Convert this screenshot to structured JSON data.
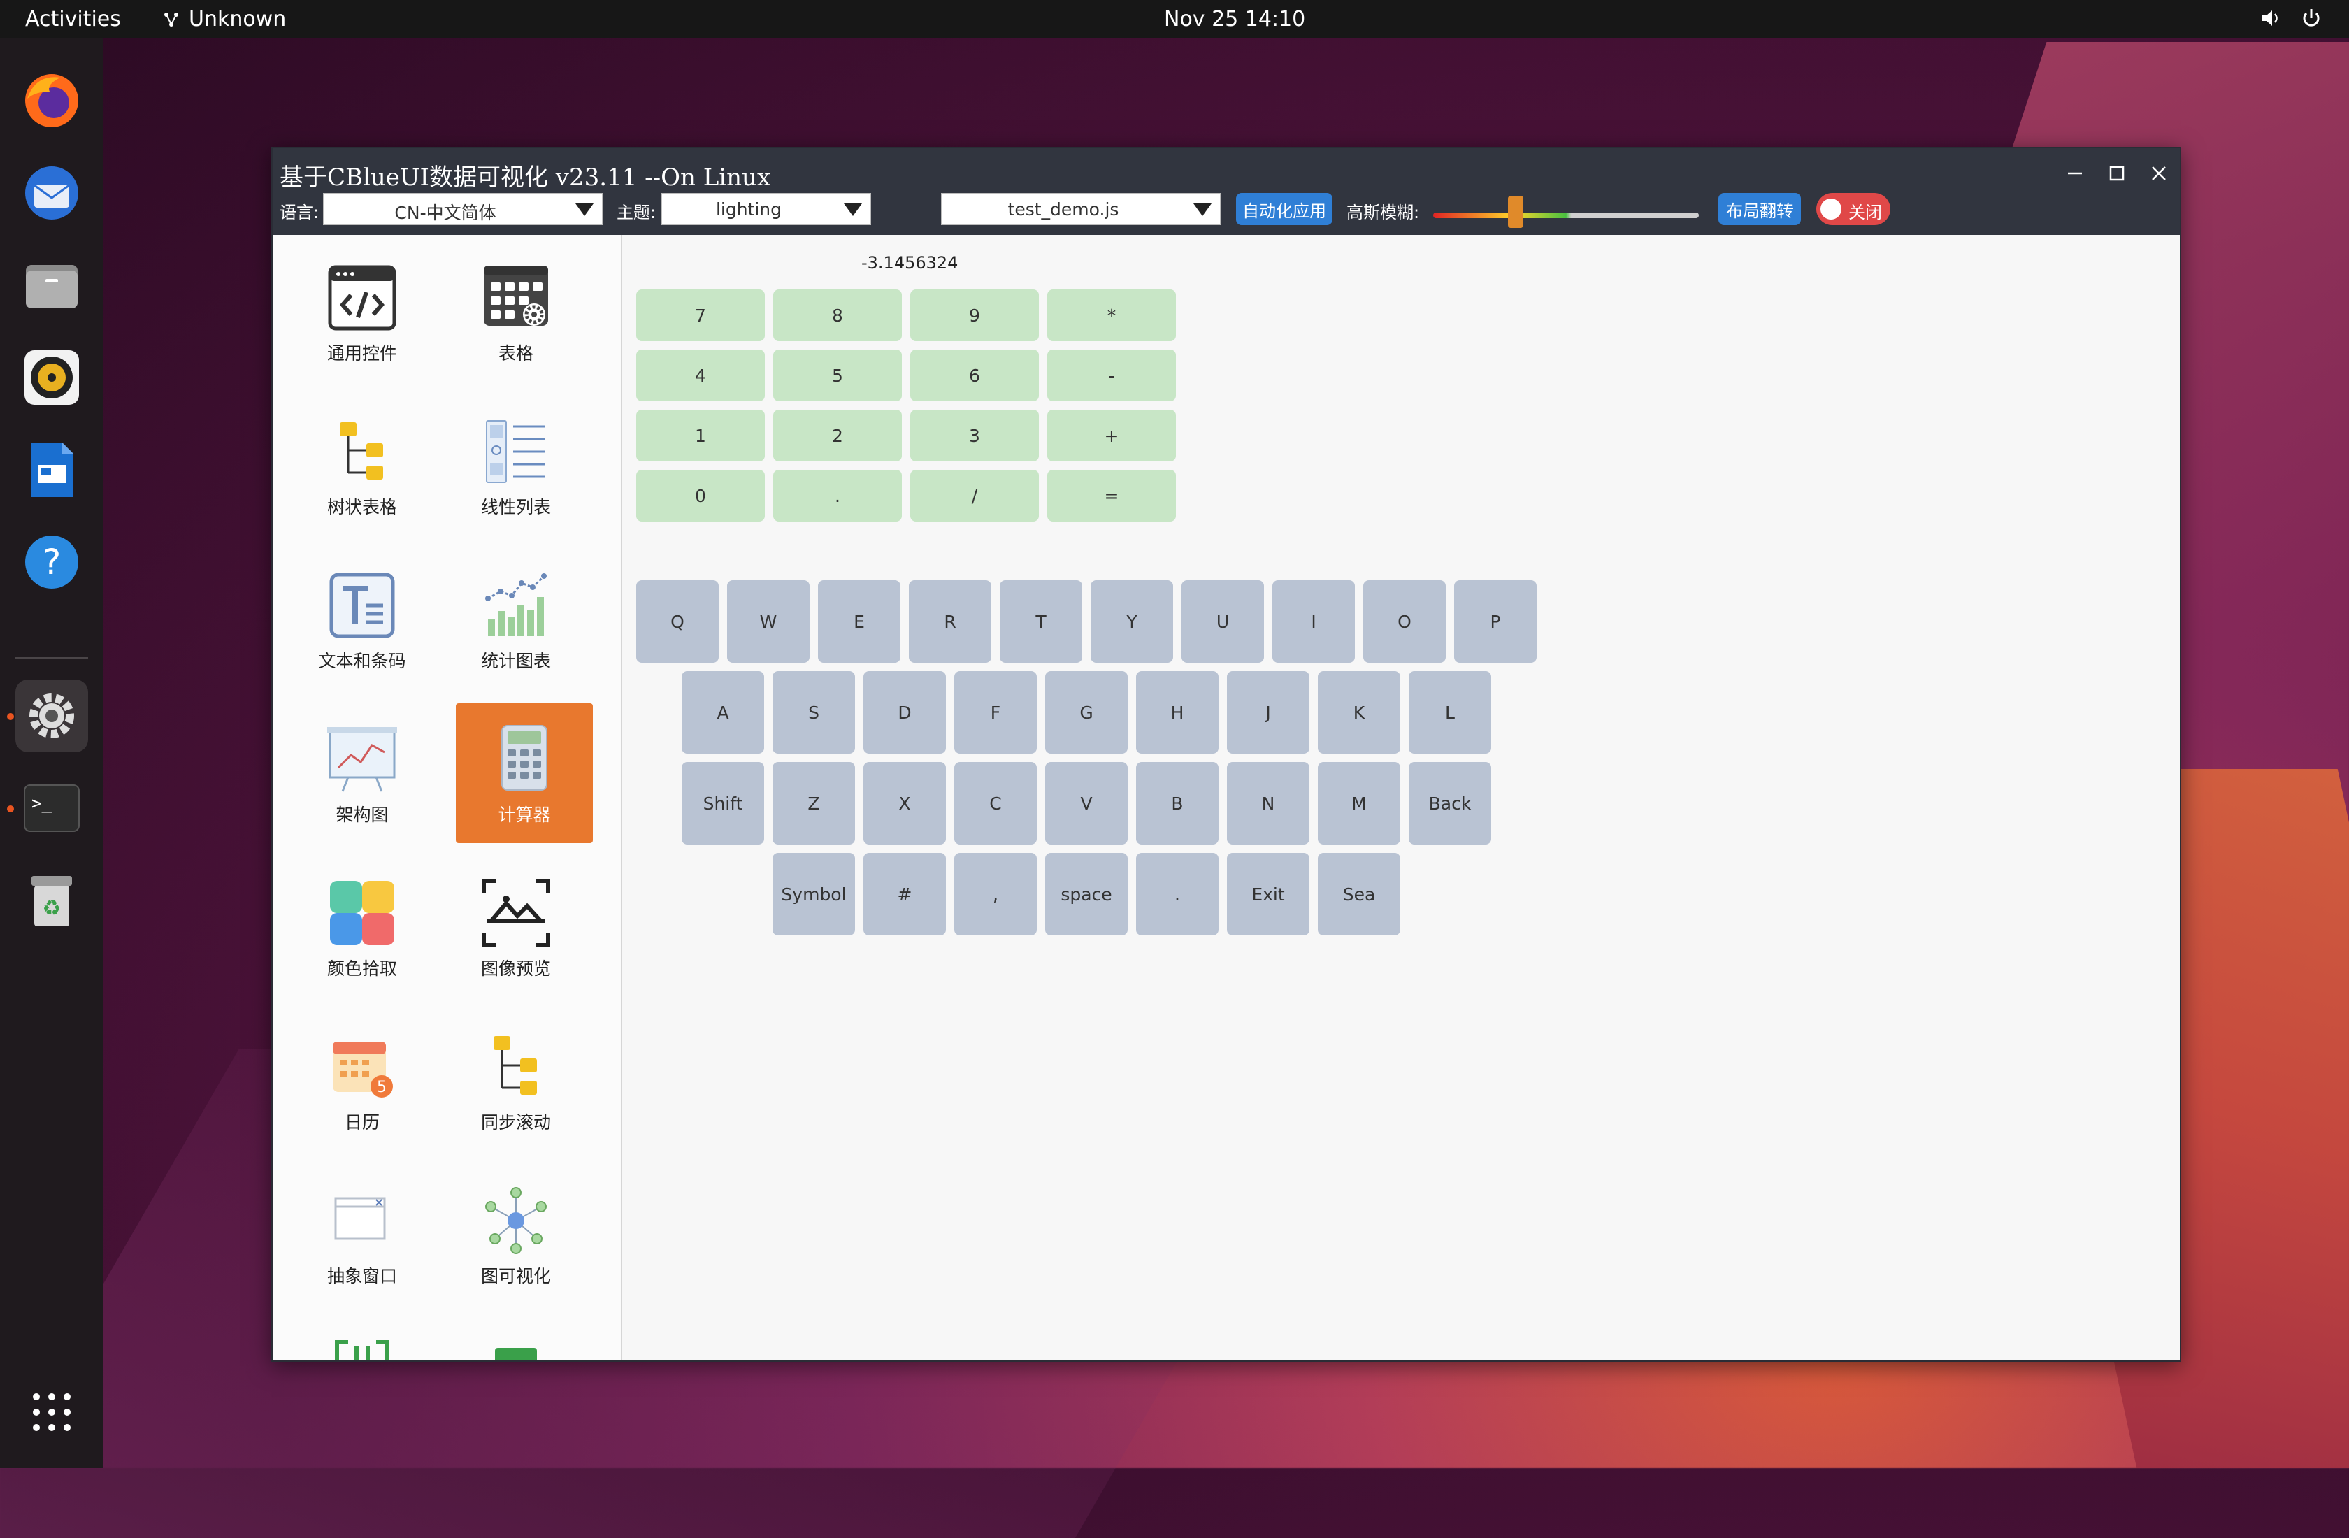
{
  "topbar": {
    "activities": "Activities",
    "app_name": "Unknown",
    "clock": "Nov 25  14:10"
  },
  "dock": {
    "items": [
      "firefox-icon",
      "thunderbird-icon",
      "files-icon",
      "rhythmbox-icon",
      "writer-icon",
      "help-icon",
      "settings-icon",
      "terminal-icon",
      "trash-icon",
      "apps-grid-icon"
    ]
  },
  "window": {
    "title": "基于CBlueUI数据可视化 v23.11 --On Linux",
    "language_label": "语言:",
    "language_value": "CN-中文简体",
    "theme_label": "主题:",
    "theme_value": "lighting",
    "script_value": "test_demo.js",
    "auto_button": "自动化应用",
    "blur_label": "高斯模糊:",
    "blur_level": 0.31,
    "layout_button": "布局翻转",
    "toggle_label": "关闭"
  },
  "sidebar": {
    "items": [
      {
        "label": "通用控件",
        "icon": "code-window-icon"
      },
      {
        "label": "表格",
        "icon": "table-gear-icon"
      },
      {
        "label": "树状表格",
        "icon": "tree-table-icon"
      },
      {
        "label": "线性列表",
        "icon": "linear-list-icon"
      },
      {
        "label": "文本和条码",
        "icon": "text-icon"
      },
      {
        "label": "统计图表",
        "icon": "bar-chart-icon"
      },
      {
        "label": "架构图",
        "icon": "presentation-chart-icon"
      },
      {
        "label": "计算器",
        "icon": "calculator-icon"
      },
      {
        "label": "颜色拾取",
        "icon": "color-picker-icon"
      },
      {
        "label": "图像预览",
        "icon": "image-preview-icon"
      },
      {
        "label": "日历",
        "icon": "calendar-icon"
      },
      {
        "label": "同步滚动",
        "icon": "sync-scroll-icon"
      },
      {
        "label": "抽象窗口",
        "icon": "abstract-window-icon"
      },
      {
        "label": "图可视化",
        "icon": "graph-visual-icon"
      }
    ],
    "selected": "计算器"
  },
  "calculator": {
    "display": "-3.1456324",
    "keys": [
      "7",
      "8",
      "9",
      "*",
      "4",
      "5",
      "6",
      "-",
      "1",
      "2",
      "3",
      "+",
      "0",
      ".",
      "/",
      "="
    ]
  },
  "keyboard": {
    "row1": [
      "Q",
      "W",
      "E",
      "R",
      "T",
      "Y",
      "U",
      "I",
      "O",
      "P"
    ],
    "row2": [
      "A",
      "S",
      "D",
      "F",
      "G",
      "H",
      "J",
      "K",
      "L"
    ],
    "row3": [
      "Shift",
      "Z",
      "X",
      "C",
      "V",
      "B",
      "N",
      "M",
      "Back"
    ],
    "row4": [
      "Symbol",
      "#",
      ",",
      "space",
      ".",
      "Exit",
      "Sea"
    ]
  }
}
